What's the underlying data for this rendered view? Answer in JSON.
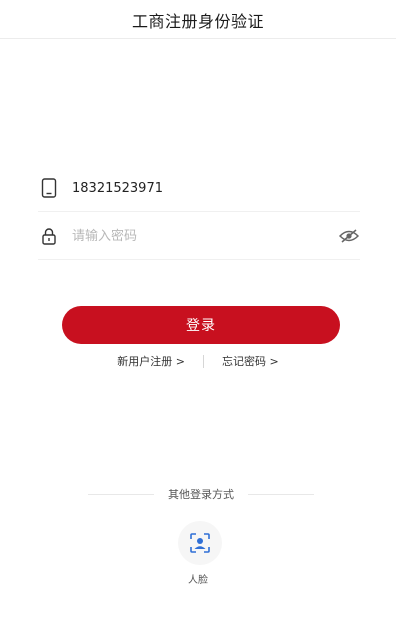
{
  "header": {
    "title": "工商注册身份验证"
  },
  "form": {
    "phone": {
      "icon": "phone-icon",
      "value": "18321523971"
    },
    "password": {
      "icon": "lock-icon",
      "placeholder": "请输入密码",
      "value": "",
      "toggle_icon": "eye-icon"
    }
  },
  "login_button": {
    "label": "登录"
  },
  "links": {
    "register": "新用户注册 >",
    "forgot": "忘记密码 >"
  },
  "other_login": {
    "title": "其他登录方式",
    "face": {
      "icon": "face-scan-icon",
      "label": "人脸"
    }
  },
  "colors": {
    "accent": "#c8101f",
    "face_icon": "#2f6fd6"
  }
}
